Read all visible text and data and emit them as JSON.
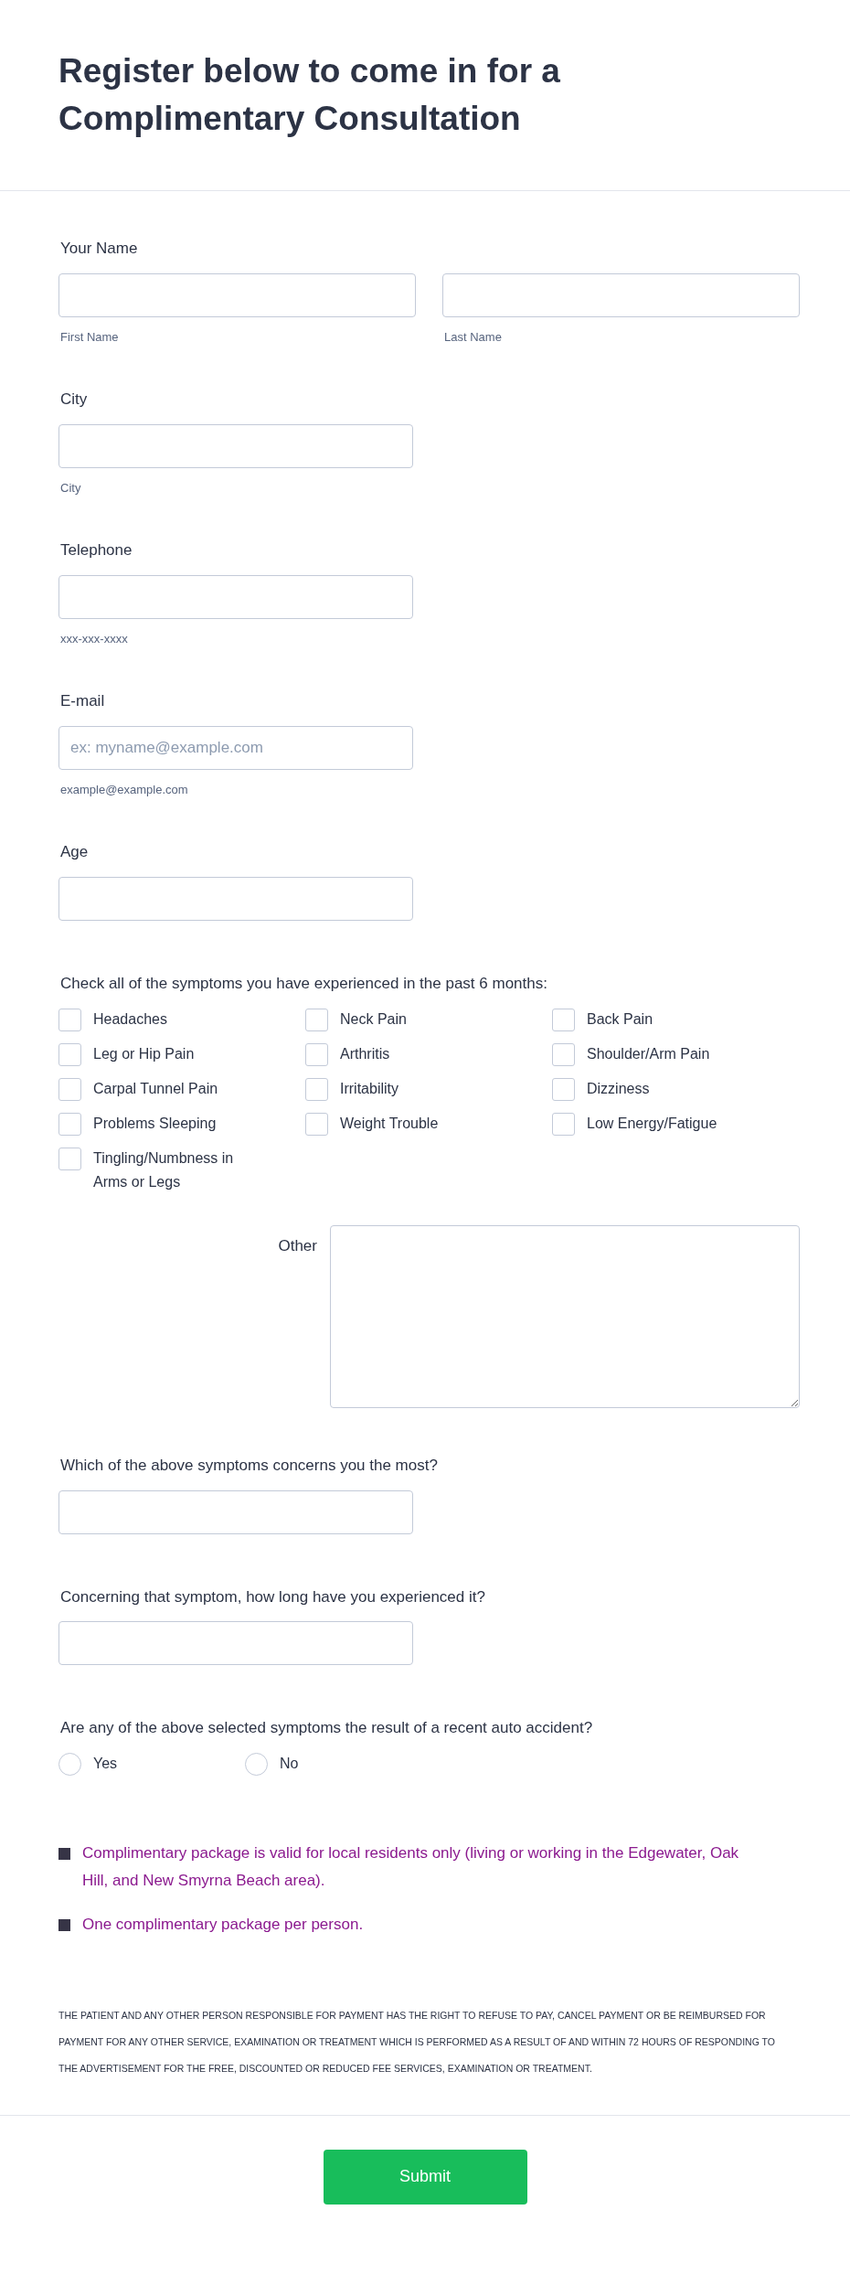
{
  "header": {
    "title": "Register below to come in for a Complimentary Consultation"
  },
  "fields": [
    {
      "kind": "name",
      "label": "Your Name",
      "inputs": [
        {
          "sublabel": "First Name"
        },
        {
          "sublabel": "Last Name"
        }
      ]
    },
    {
      "kind": "input",
      "label": "City",
      "sublabel": "City"
    },
    {
      "kind": "input",
      "label": "Telephone",
      "sublabel": "xxx-xxx-xxxx"
    },
    {
      "kind": "input",
      "label": "E-mail",
      "placeholder": "ex: myname@example.com",
      "sublabel": "example@example.com"
    },
    {
      "kind": "input",
      "label": "Age"
    },
    {
      "kind": "checklist",
      "label": "Check all of the symptoms you have experienced in the past 6 months:",
      "options": [
        {
          "label": "Headaches",
          "checked": false
        },
        {
          "label": "Neck Pain",
          "checked": false
        },
        {
          "label": "Back Pain",
          "checked": false
        },
        {
          "label": "Leg or Hip Pain",
          "checked": false
        },
        {
          "label": "Arthritis",
          "checked": false
        },
        {
          "label": "Shoulder/Arm Pain",
          "checked": false
        },
        {
          "label": "Carpal Tunnel Pain",
          "checked": false
        },
        {
          "label": "Irritability",
          "checked": false
        },
        {
          "label": "Dizziness",
          "checked": false
        },
        {
          "label": "Problems Sleeping",
          "checked": false
        },
        {
          "label": "Weight Trouble",
          "checked": false
        },
        {
          "label": "Low Energy/Fatigue",
          "checked": false
        },
        {
          "label": "Tingling/Numbness in Arms or Legs",
          "checked": false
        }
      ]
    },
    {
      "kind": "textarea",
      "label": "Other"
    },
    {
      "kind": "input",
      "label": "Which of the above symptoms concerns you the most?"
    },
    {
      "kind": "input",
      "label": "Concerning that symptom, how long have you experienced it?"
    },
    {
      "kind": "radio",
      "label": "Are any of the above selected symptoms the result of a recent auto accident?",
      "options": [
        {
          "label": "Yes",
          "selected": false
        },
        {
          "label": "No",
          "selected": false
        }
      ]
    }
  ],
  "notes": [
    "Complimentary package is valid for local residents only (living or working in the Edgewater, Oak Hill, and New Smyrna Beach area).",
    "One complimentary package per person."
  ],
  "disclaimer": "THE PATIENT AND ANY OTHER PERSON RESPONSIBLE FOR PAYMENT HAS THE RIGHT TO REFUSE TO PAY, CANCEL PAYMENT OR BE REIMBURSED FOR PAYMENT FOR ANY OTHER SERVICE, EXAMINATION OR TREATMENT WHICH IS PERFORMED AS A RESULT OF AND WITHIN 72 HOURS OF RESPONDING TO THE ADVERTISEMENT FOR THE FREE, DISCOUNTED OR REDUCED FEE SERVICES, EXAMINATION OR TREATMENT.",
  "submit": {
    "label": "Submit"
  }
}
